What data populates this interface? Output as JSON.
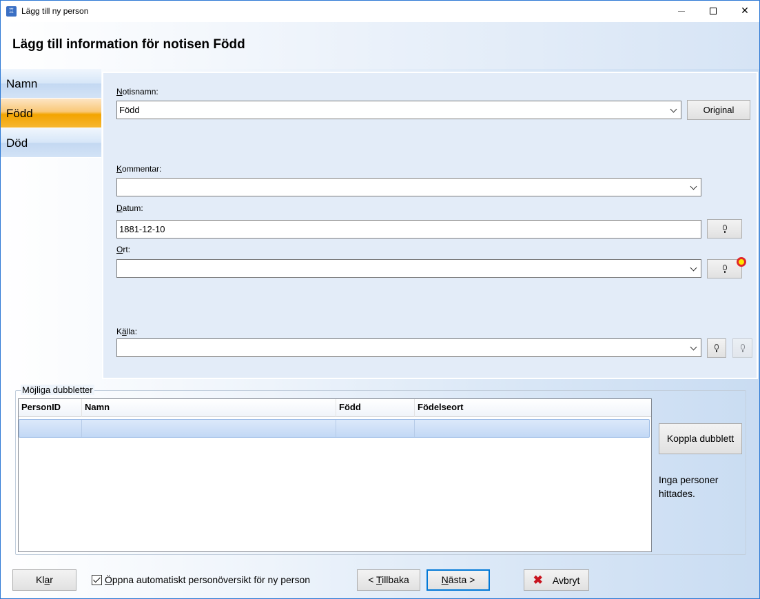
{
  "window": {
    "title": "Lägg till ny person",
    "controls": {
      "minimize": "—",
      "maximize": "☐",
      "close": "✕"
    }
  },
  "header": {
    "title": "Lägg till information för notisen Född"
  },
  "nav": {
    "items": [
      {
        "label": "Namn"
      },
      {
        "label": "Född"
      },
      {
        "label": "Död"
      }
    ],
    "active": "Född"
  },
  "form": {
    "notisnamn": {
      "label_u": "N",
      "label_rest": "otisnamn:",
      "value": "Född"
    },
    "original_button": "Original",
    "kommentar": {
      "label_u": "K",
      "label_rest": "ommentar:",
      "value": ""
    },
    "datum": {
      "label_u": "D",
      "label_rest": "atum:",
      "value": "1881-12-10"
    },
    "ort": {
      "label_u": "O",
      "label_rest": "rt:",
      "value": ""
    },
    "kalla": {
      "label_pre": "K",
      "label_u": "ä",
      "label_rest": "lla:",
      "value": ""
    }
  },
  "duplicates": {
    "group_title": "Möjliga dubbletter",
    "columns": [
      "PersonID",
      "Namn",
      "Född",
      "Födelseort"
    ],
    "rows": [],
    "link_button": "Koppla dubblett",
    "status_text": "Inga personer hittades."
  },
  "footer": {
    "done_pre": "Kl",
    "done_u": "a",
    "done_post": "r",
    "auto_open_checked": true,
    "auto_open_label_u": "Ö",
    "auto_open_label_rest": "ppna automatiskt personöversikt för ny person",
    "back_pre": "< ",
    "back_u": "T",
    "back_rest": "illbaka",
    "next_u": "N",
    "next_rest": "ästa >",
    "cancel": "Avbryt"
  },
  "colors": {
    "active_nav": "#f3a400",
    "nav": "#c3d8f2",
    "panel": "#e3ecf8",
    "alert_ring": "#e0282b",
    "alert_fill": "#ffe600",
    "cancel_icon": "#c8141e"
  }
}
